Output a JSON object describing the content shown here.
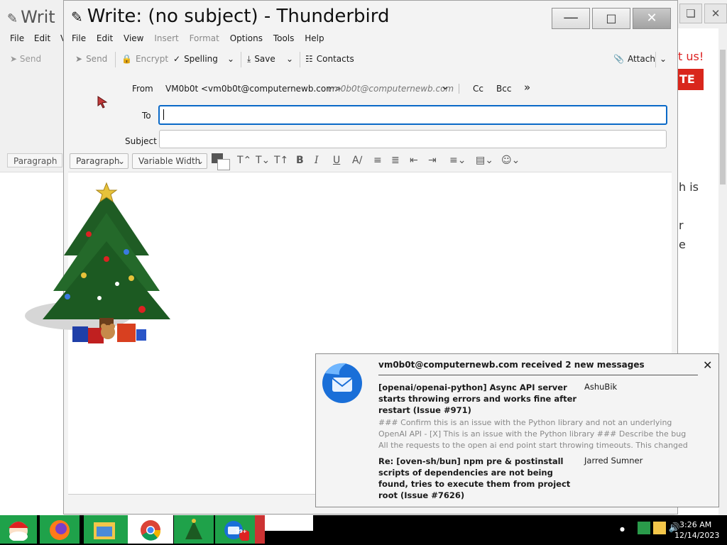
{
  "background_window": {
    "title": "Writ",
    "menu": [
      "File",
      "Edit",
      "Vi"
    ],
    "send_label": "Send",
    "paragraph_label": "Paragraph",
    "right_text_1": "t us!",
    "right_button": "TE",
    "right_text_2": "h is",
    "right_text_3": "r",
    "right_text_4": "e"
  },
  "window": {
    "title": "Write: (no subject) - Thunderbird"
  },
  "menu": {
    "file": "File",
    "edit": "Edit",
    "view": "View",
    "insert": "Insert",
    "format": "Format",
    "options": "Options",
    "tools": "Tools",
    "help": "Help"
  },
  "toolbar": {
    "send": "Send",
    "encrypt": "Encrypt",
    "spelling": "Spelling",
    "save": "Save",
    "contacts": "Contacts",
    "attach": "Attach"
  },
  "headers": {
    "from_label": "From",
    "from_value": "VM0b0t <vm0b0t@computernewb.com>",
    "from_identity": "vm0b0t@computernewb.com",
    "cc": "Cc",
    "bcc": "Bcc",
    "to_label": "To",
    "to_value": "",
    "subject_label": "Subject",
    "subject_value": ""
  },
  "format_bar": {
    "paragraph": "Paragraph",
    "font": "Variable Width"
  },
  "notification": {
    "title": "vm0b0t@computernewb.com received 2 new messages",
    "messages": [
      {
        "subject": "[openai/openai-python] Async API server starts throwing errors and works fine after restart (Issue #971)",
        "author": "AshuBik",
        "preview": "### Confirm this is an issue with the Python library and not an underlying OpenAI API - [X] This is an issue with the Python library ### Describe the bug All the requests to the open ai end point start throwing timeouts. This changed after doing"
      },
      {
        "subject": "Re: [oven-sh/bun] npm pre & postinstall scripts of dependencies are not being found, tries to execute them from project root (Issue #7626)",
        "author": "Jarred Sumner",
        "preview": ""
      }
    ]
  },
  "taskbar": {
    "items": [
      "start-santa",
      "firefox",
      "file-explorer",
      "chrome",
      "christmas-tree",
      "thunderbird"
    ],
    "badge": "99+",
    "time": "3:26 AM",
    "date": "12/14/2023"
  },
  "colors": {
    "accent": "#0a69c7",
    "taskbar_green": "#1fa24a",
    "taskbar_bg": "#000000",
    "brand_red": "#d9261c"
  }
}
